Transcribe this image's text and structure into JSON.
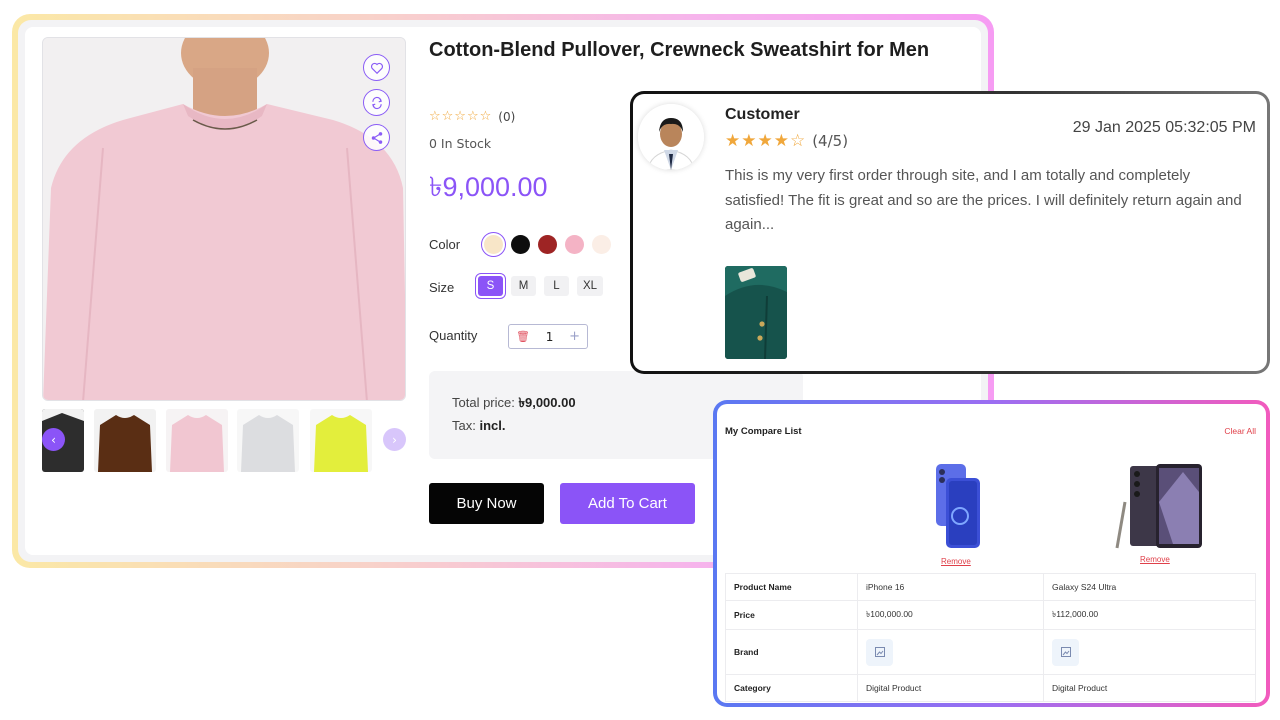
{
  "product": {
    "title": "Cotton-Blend Pullover, Crewneck Sweatshirt for Men",
    "rating_count": "(0)",
    "stock": "0 In Stock",
    "price": "৳9,000.00",
    "color_label": "Color",
    "colors": [
      "#f8e6c8",
      "#0d0d0d",
      "#9e2424",
      "#f4b3c5",
      "#fbeee6"
    ],
    "size_label": "Size",
    "sizes": [
      "S",
      "M",
      "L",
      "XL"
    ],
    "selected_size": "S",
    "quantity_label": "Quantity",
    "quantity": "1",
    "total_label": "Total price:",
    "total_value": "৳9,000.00",
    "tax_label": "Tax:",
    "tax_value": "incl.",
    "buy_now": "Buy Now",
    "add_to_cart": "Add To Cart",
    "accent_color": "#8b54f7"
  },
  "review": {
    "name": "Customer",
    "rating_text": "(4/5)",
    "date": "29 Jan 2025 05:32:05 PM",
    "text": "This is my very first order through site, and I am totally and completely satisfied! The fit is great and so are the prices. I will definitely return again and again..."
  },
  "compare": {
    "title": "My Compare List",
    "clear_all": "Clear All",
    "remove_label": "Remove",
    "rows": [
      {
        "label": "Product Name",
        "values": [
          "iPhone 16",
          "Galaxy S24 Ultra"
        ]
      },
      {
        "label": "Price",
        "values": [
          "৳100,000.00",
          "৳112,000.00"
        ]
      },
      {
        "label": "Brand",
        "values": [
          "",
          ""
        ]
      },
      {
        "label": "Category",
        "values": [
          "Digital Product",
          "Digital Product"
        ]
      }
    ]
  }
}
